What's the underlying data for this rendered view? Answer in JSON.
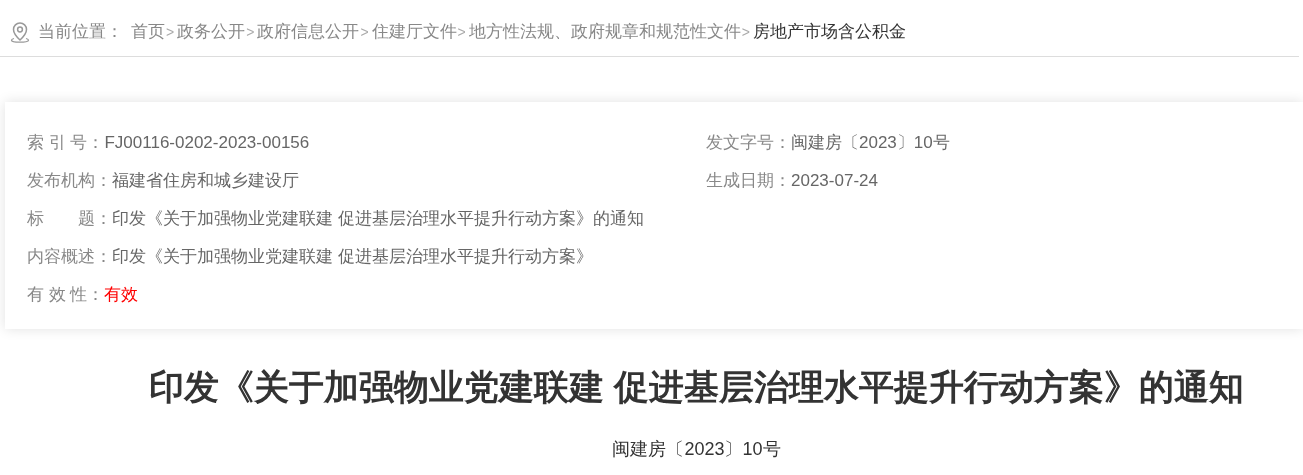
{
  "breadcrumb": {
    "label": "当前位置：",
    "items": [
      {
        "text": "首页",
        "separator": ">",
        "current": false
      },
      {
        "text": "政务公开",
        "separator": ">",
        "current": false
      },
      {
        "text": "政府信息公开",
        "separator": ">",
        "current": false
      },
      {
        "text": "住建厅文件",
        "separator": ">",
        "current": false
      },
      {
        "text": "地方性法规、政府规章和规范性文件",
        "separator": ">",
        "current": false
      },
      {
        "text": "房地产市场含公积金",
        "current": true
      }
    ]
  },
  "info": {
    "left": [
      {
        "label": "索 引 号：",
        "value": "FJ00116-0202-2023-00156"
      },
      {
        "label": "发布机构：",
        "value": "福建省住房和城乡建设厅"
      },
      {
        "label": "标　　题：",
        "value": "印发《关于加强物业党建联建 促进基层治理水平提升行动方案》的通知"
      },
      {
        "label": "内容概述：",
        "value": "印发《关于加强物业党建联建 促进基层治理水平提升行动方案》"
      },
      {
        "label": "有 效 性：",
        "value": "有效",
        "color": "#ff0000"
      }
    ],
    "right": [
      {
        "label": "发文字号：",
        "value": "闽建房〔2023〕10号"
      },
      {
        "label": "生成日期：",
        "value": "2023-07-24"
      }
    ]
  },
  "article": {
    "title": "印发《关于加强物业党建联建 促进基层治理水平提升行动方案》的通知",
    "doc_number": "闽建房〔2023〕10号"
  }
}
